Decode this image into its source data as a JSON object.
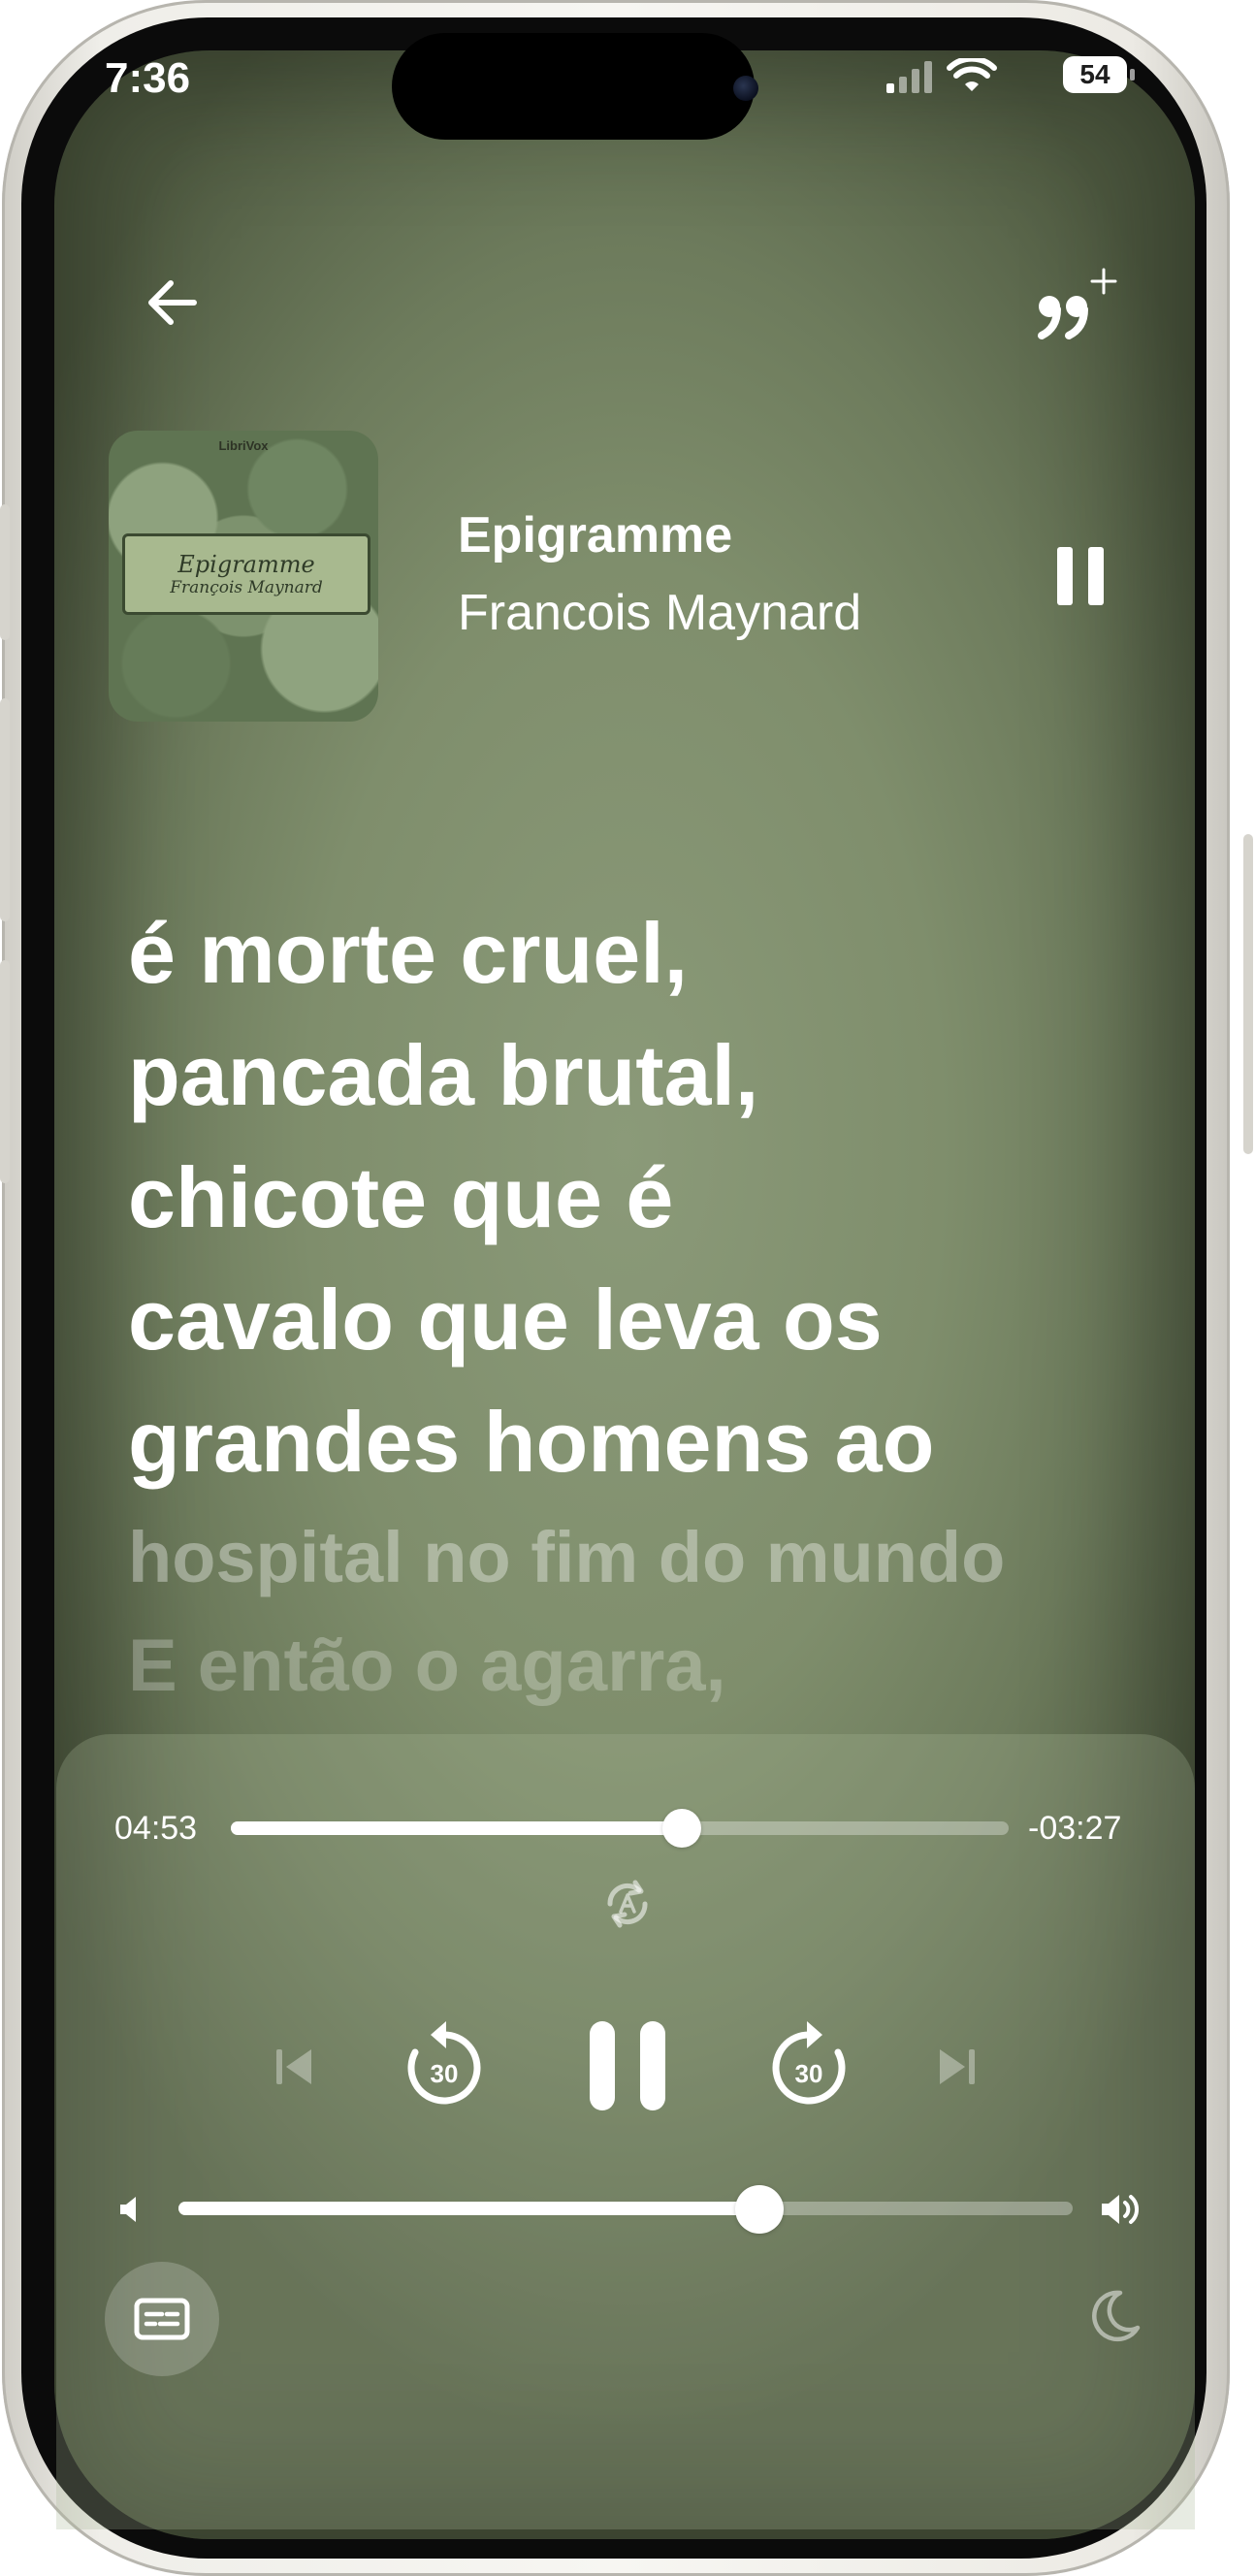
{
  "status_bar": {
    "time": "7:36",
    "battery": "54"
  },
  "header": {
    "back_icon": "arrow-left-icon",
    "quote_icon": "quote-plus-icon"
  },
  "now_playing": {
    "cover": {
      "publisher": "LibriVox",
      "title": "Epigramme",
      "author": "François Maynard"
    },
    "title": "Epigramme",
    "author": "Francois Maynard",
    "mini_button_icon": "pause-icon"
  },
  "lyrics": {
    "current": [
      "é morte cruel,",
      "pancada brutal,",
      "chicote que é",
      "cavalo que leva os",
      "grandes homens ao"
    ],
    "upcoming": [
      "hospital no fim do mundo",
      "E então o agarra,"
    ]
  },
  "player": {
    "elapsed": "04:53",
    "remaining": "-03:27",
    "progress": 0.58,
    "rewind_seconds": "30",
    "forward_seconds": "30",
    "volume": 0.65,
    "colors": {
      "accent": "#ffffff",
      "background": "#7f8e6c"
    }
  }
}
